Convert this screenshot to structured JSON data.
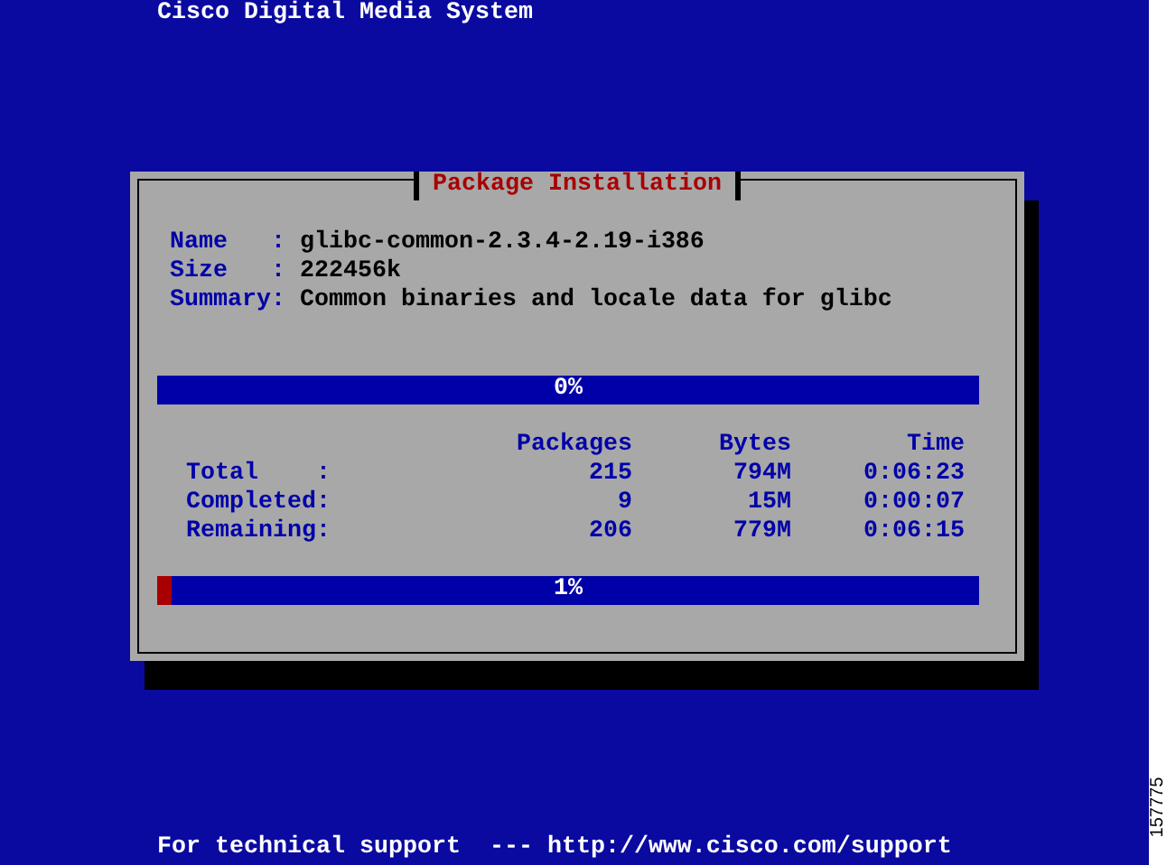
{
  "header": {
    "title": "Cisco Digital Media System"
  },
  "dialog": {
    "title": "Package Installation",
    "fields": [
      {
        "label": "Name   :",
        "value": "glibc-common-2.3.4-2.19-i386"
      },
      {
        "label": "Size   :",
        "value": "222456k"
      },
      {
        "label": "Summary:",
        "value": "Common binaries and locale data for glibc"
      }
    ],
    "package_progress": {
      "label": "0%",
      "level": 0
    },
    "stats": {
      "columns": [
        "Packages",
        "Bytes",
        "Time"
      ],
      "rows": [
        {
          "label": "Total    :",
          "values": [
            "215",
            "794M",
            "0:06:23"
          ]
        },
        {
          "label": "Completed:",
          "values": [
            "9",
            "15M",
            "0:00:07"
          ]
        },
        {
          "label": "Remaining:",
          "values": [
            "206",
            "779M",
            "0:06:15"
          ]
        }
      ]
    },
    "total_progress": {
      "label": "1%",
      "level": 0.018
    }
  },
  "footer": {
    "text": "For technical support  --- http://www.cisco.com/support"
  },
  "figure_number": "157775"
}
